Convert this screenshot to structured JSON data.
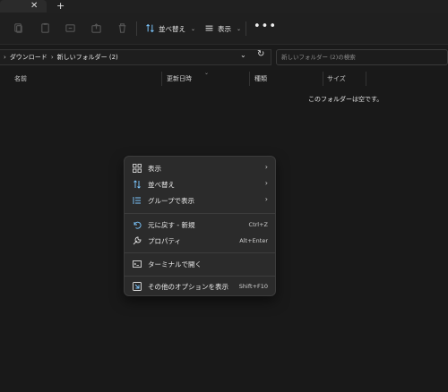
{
  "tabbar": {
    "close_glyph": "✕",
    "new_tab_glyph": "+"
  },
  "toolbar": {
    "icons": [
      "cut-icon",
      "copy-icon",
      "paste-icon",
      "rename-icon",
      "share-icon",
      "delete-icon"
    ],
    "sort_label": "並べ替え",
    "view_label": "表示",
    "more_glyph": "•••"
  },
  "address": {
    "crumbs": [
      "ダウンロード",
      "新しいフォルダー (2)"
    ],
    "search_placeholder": "新しいフォルダー (2)の検索"
  },
  "columns": [
    "名前",
    "更新日時",
    "種類",
    "サイズ"
  ],
  "empty_message": "このフォルダーは空です。",
  "context_menu": {
    "items": [
      {
        "label": "表示",
        "icon": "grid-icon",
        "submenu": true
      },
      {
        "label": "並べ替え",
        "icon": "sort-icon",
        "submenu": true
      },
      {
        "label": "グループで表示",
        "icon": "group-icon",
        "submenu": true
      },
      {
        "label": "元に戻す - 新規",
        "icon": "undo-icon",
        "shortcut": "Ctrl+Z"
      },
      {
        "label": "プロパティ",
        "icon": "wrench-icon",
        "shortcut": "Alt+Enter"
      },
      {
        "label": "ターミナルで開く",
        "icon": "terminal-icon"
      },
      {
        "label": "その他のオプションを表示",
        "icon": "more-options-icon",
        "shortcut": "Shift+F10"
      }
    ]
  },
  "colors": {
    "accent": "#4cc2ff",
    "background": "#191919",
    "menu_bg": "#2b2b2b"
  }
}
